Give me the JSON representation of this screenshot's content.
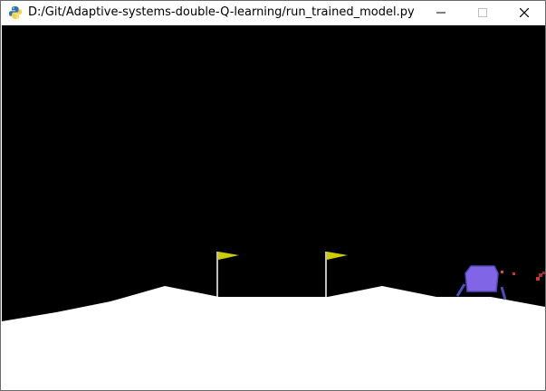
{
  "window": {
    "title": "D:/Git/Adaptive-systems-double-Q-learning/run_trained_model.py",
    "app_icon": "python-icon",
    "controls": {
      "minimize_icon": "minimize-icon",
      "maximize_icon": "maximize-icon",
      "close_icon": "close-icon"
    }
  },
  "game": {
    "environment": "lunar-lander",
    "colors": {
      "sky": "#000000",
      "terrain": "#ffffff",
      "flag_pole": "#ffffff",
      "flag": "#cccc00",
      "lander_body": "#8066e6",
      "lander_legs": "#4d4db3",
      "particles": "#cc3333"
    }
  }
}
